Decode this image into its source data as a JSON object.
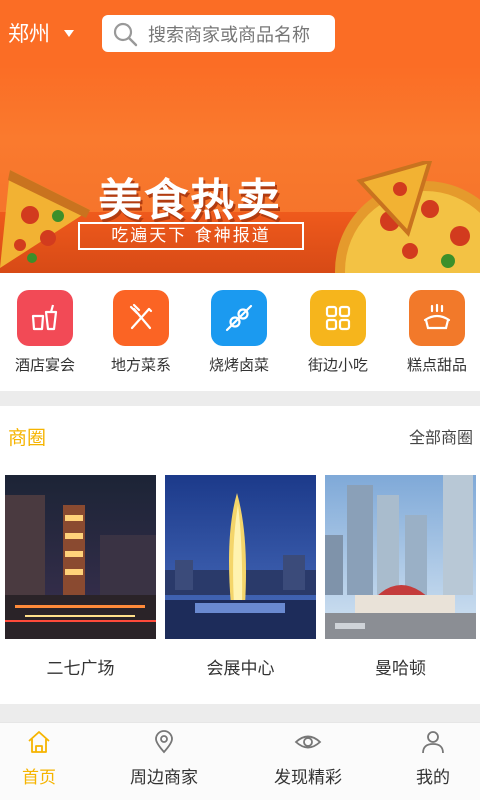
{
  "header": {
    "city": "郑州",
    "search_placeholder": "搜索商家或商品名称"
  },
  "banner": {
    "title": "美食热卖",
    "subtitle": "吃遍天下 食神报道"
  },
  "categories": [
    {
      "label": "酒店宴会",
      "icon": "drink-icon",
      "color": "#f24a56"
    },
    {
      "label": "地方菜系",
      "icon": "fork-knife-icon",
      "color": "#fb6424"
    },
    {
      "label": "烧烤卤菜",
      "icon": "skewer-icon",
      "color": "#1b9af0"
    },
    {
      "label": "街边小吃",
      "icon": "grid-icon",
      "color": "#f6b51c"
    },
    {
      "label": "糕点甜品",
      "icon": "dessert-icon",
      "color": "#f2792a"
    }
  ],
  "business": {
    "title": "商圈",
    "all_label": "全部商圈",
    "items": [
      {
        "name": "二七广场"
      },
      {
        "name": "会展中心"
      },
      {
        "name": "曼哈顿"
      }
    ]
  },
  "tabbar": {
    "items": [
      {
        "label": "首页",
        "icon": "home-icon",
        "active": true
      },
      {
        "label": "周边商家",
        "icon": "location-pin-icon",
        "active": false
      },
      {
        "label": "发现精彩",
        "icon": "eye-icon",
        "active": false
      },
      {
        "label": "我的",
        "icon": "user-icon",
        "active": false
      }
    ]
  },
  "colors": {
    "header": "#fb6d25",
    "accent": "#f6b400"
  }
}
